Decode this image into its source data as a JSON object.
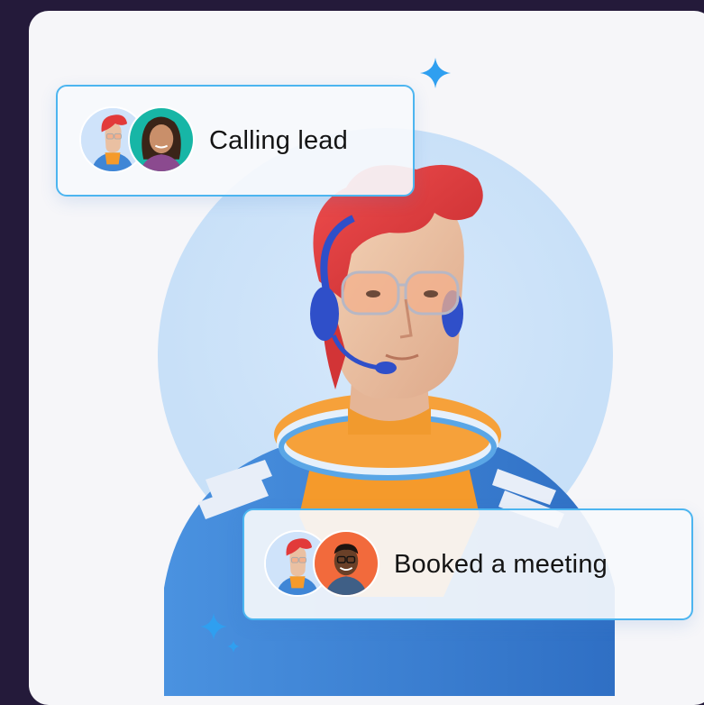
{
  "card": {
    "background": "#f6f6f9",
    "page_background": "#241a3a",
    "accent": "#4cb5f0"
  },
  "illustration": {
    "subject": "support-agent-with-headset",
    "hair_color": "#e23a3a",
    "jacket_color": "#3f86d6",
    "collar_color": "#f59a2b"
  },
  "status_top": {
    "label": "Calling lead",
    "avatars": [
      "agent-avatar",
      "lead-avatar-woman"
    ]
  },
  "status_bottom": {
    "label": "Booked a meeting",
    "avatars": [
      "agent-avatar",
      "lead-avatar-man"
    ]
  },
  "sparkles": [
    "sparkle-icon",
    "sparkle-icon",
    "sparkle-icon"
  ]
}
